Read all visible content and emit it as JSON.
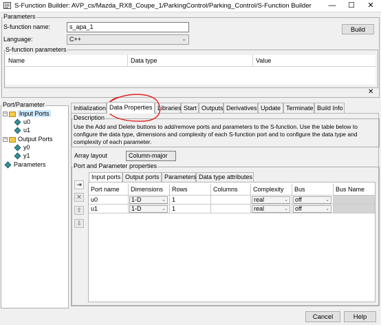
{
  "window": {
    "title": "S-Function Builder: AVP_cs/Mazda_RX8_Coupe_1/ParkingControl/Parking_Control/S-Function Builder",
    "minimize_glyph": "—",
    "maximize_glyph": "☐",
    "close_glyph": "✕"
  },
  "parameters": {
    "group_label": "Parameters",
    "sfunction_name_label": "S-function name:",
    "sfunction_name_value": "s_apa_1",
    "language_label": "Language:",
    "language_value": "C++",
    "build_label": "Build"
  },
  "sfunction_parameters": {
    "group_label": "S-function parameters",
    "columns": [
      "Name",
      "Data type",
      "Value"
    ],
    "close_glyph": "✕"
  },
  "port_parameter": {
    "group_label": "Port/Parameter",
    "tree": [
      {
        "label": "Input Ports",
        "kind": "folder",
        "selected": true
      },
      {
        "label": "u0",
        "kind": "leaf"
      },
      {
        "label": "u1",
        "kind": "leaf"
      },
      {
        "label": "Output Ports",
        "kind": "folder",
        "selected": false
      },
      {
        "label": "y0",
        "kind": "leaf"
      },
      {
        "label": "y1",
        "kind": "leaf"
      },
      {
        "label": "Parameters",
        "kind": "leaf"
      }
    ]
  },
  "tabs": [
    {
      "label": "Initialization",
      "active": false
    },
    {
      "label": "Data Properties",
      "active": true
    },
    {
      "label": "Libraries",
      "active": false
    },
    {
      "label": "Start",
      "active": false
    },
    {
      "label": "Outputs",
      "active": false
    },
    {
      "label": "Derivatives",
      "active": false
    },
    {
      "label": "Update",
      "active": false
    },
    {
      "label": "Terminate",
      "active": false
    },
    {
      "label": "Build Info",
      "active": false
    }
  ],
  "description": {
    "group_label": "Description",
    "text": "Use the Add and Delete buttons to add/remove ports and parameters to the S-function. Use the table below to configure the data type, dimensions and complexity of each S-function port and to configure the data type and complexity of each parameter."
  },
  "array_layout": {
    "label": "Array layout",
    "value": "Column-major"
  },
  "port_props": {
    "group_label": "Port and Parameter properties",
    "tabs": [
      {
        "label": "Input ports",
        "active": true
      },
      {
        "label": "Output ports",
        "active": false
      },
      {
        "label": "Parameters",
        "active": false
      },
      {
        "label": "Data type attributes",
        "active": false
      }
    ],
    "columns": [
      "Port name",
      "Dimensions",
      "Rows",
      "Columns",
      "Complexity",
      "Bus",
      "Bus Name"
    ],
    "rows": [
      {
        "port_name": "u0",
        "dimensions": "1-D",
        "rows": "1",
        "columns": "",
        "complexity": "real",
        "bus": "off",
        "bus_name": ""
      },
      {
        "port_name": "u1",
        "dimensions": "1-D",
        "rows": "1",
        "columns": "",
        "complexity": "real",
        "bus": "off",
        "bus_name": ""
      }
    ],
    "side_buttons": [
      {
        "name": "add-port-icon",
        "glyph": "⇥"
      },
      {
        "name": "delete-port-icon",
        "glyph": "✕"
      },
      {
        "name": "move-up-icon",
        "glyph": "⇧"
      },
      {
        "name": "move-down-icon",
        "glyph": "⇩"
      }
    ]
  },
  "footer": {
    "cancel_label": "Cancel",
    "help_label": "Help"
  },
  "colors": {
    "annotation_circle": "#e02020",
    "selection": "#cce8ff",
    "bus_name_disabled": "#d4d4d4"
  }
}
